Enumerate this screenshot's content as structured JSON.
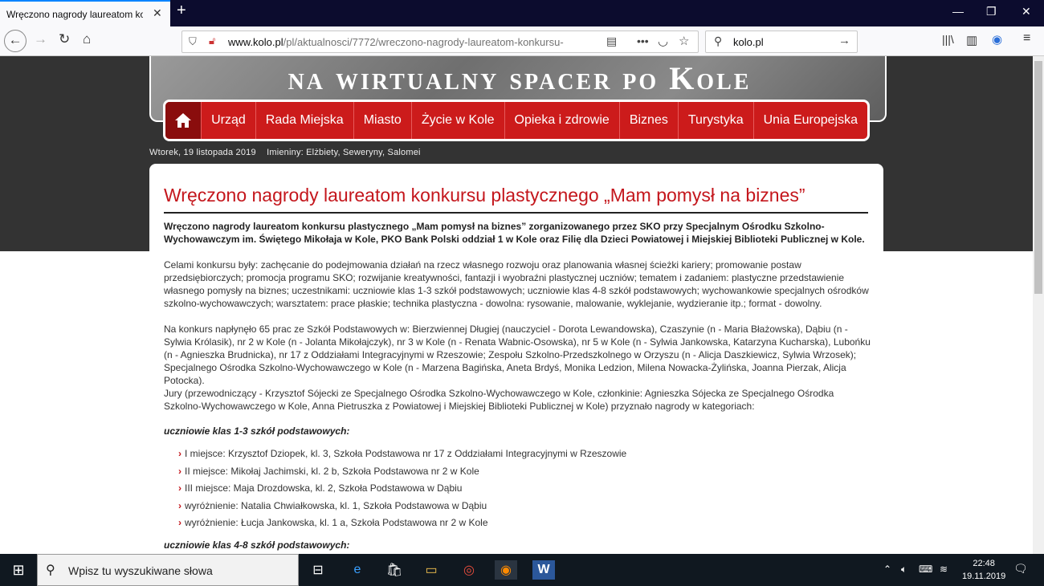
{
  "browser": {
    "tab_title": "Wręczono nagrody laureatom konk",
    "url_domain": "www.kolo.pl",
    "url_path": "/pl/aktualnosci/7772/wreczono-nagrody-laureatom-konkursu-",
    "search_value": "kolo.pl",
    "more": "•••"
  },
  "banner": {
    "text": "na wirtualny spacer po Kole"
  },
  "menu": {
    "items": [
      "Urząd",
      "Rada Miejska",
      "Miasto",
      "Życie w Kole",
      "Opieka i zdrowie",
      "Biznes",
      "Turystyka",
      "Unia Europejska"
    ]
  },
  "dateline": {
    "date": "Wtorek, 19 listopada 2019",
    "names": "Imieniny: Elżbiety, Seweryny, Salomei"
  },
  "article": {
    "title": "Wręczono nagrody laureatom konkursu plastycznego „Mam pomysł na biznes”",
    "lead": "Wręczono nagrody laureatom konkursu plastycznego „Mam pomysł na biznes” zorganizowanego przez SKO przy Specjalnym Ośrodku Szkolno-Wychowawczym im. Świętego Mikołaja w Kole, PKO Bank Polski oddział 1 w Kole oraz Filię dla Dzieci Powiatowej i Miejskiej Biblioteki Publicznej w Kole.",
    "p1": "Celami konkursu były: zachęcanie do podejmowania działań na rzecz własnego rozwoju oraz planowania własnej ścieżki kariery; promowanie postaw przedsiębiorczych; promocja programu SKO; rozwijanie kreatywności, fantazji i wyobraźni plastycznej uczniów; tematem i zadaniem: plastyczne przedstawienie własnego pomysły na biznes; uczestnikami: uczniowie klas 1-3 szkół podstawowych; uczniowie klas 4-8 szkół podstawowych; wychowankowie specjalnych ośrodków szkolno-wychowawczych; warsztatem: prace płaskie; technika plastyczna - dowolna: rysowanie, malowanie, wyklejanie, wydzieranie itp.; format - dowolny.",
    "p2": "Na konkurs napłynęło 65 prac ze Szkół Podstawowych w: Bierzwiennej Długiej (nauczyciel - Dorota Lewandowska), Czaszynie (n - Maria Błażowska), Dąbiu (n - Sylwia Królasik), nr 2 w Kole (n - Jolanta Mikołajczyk), nr 3 w Kole (n - Renata Wabnic-Osowska), nr 5 w Kole (n - Sylwia Jankowska, Katarzyna Kucharska), Lubońku (n - Agnieszka Brudnicka), nr 17 z Oddziałami Integracyjnymi w Rzeszowie; Zespołu Szkolno-Przedszkolnego w Orzyszu (n - Alicja Daszkiewicz, Sylwia Wrzosek); Specjalnego Ośrodka Szkolno-Wychowawczego w Kole (n - Marzena Bagińska, Aneta Brdyś, Monika Ledzion, Milena Nowacka-Żylińska, Joanna Pierzak, Alicja Potocka).",
    "p3": "Jury (przewodniczący - Krzysztof Sójecki ze Specjalnego Ośrodka Szkolno-Wychowawczego w Kole, członkinie: Agnieszka Sójecka ze Specjalnego Ośrodka Szkolno-Wychowawczego w Kole, Anna Pietruszka z Powiatowej i Miejskiej Biblioteki Publicznej w Kole) przyznało nagrody w kategoriach:",
    "cat1": "uczniowie klas 1-3 szkół podstawowych:",
    "list1": [
      "I miejsce: Krzysztof Dziopek, kl. 3, Szkoła Podstawowa nr 17 z Oddziałami Integracyjnymi w Rzeszowie",
      "II miejsce: Mikołaj Jachimski, kl. 2 b, Szkoła Podstawowa nr 2 w Kole",
      "III miejsce: Maja Drozdowska, kl. 2, Szkoła Podstawowa w Dąbiu",
      "wyróżnienie: Natalia Chwiałkowska, kl. 1, Szkoła Podstawowa w Dąbiu",
      "wyróżnienie: Łucja Jankowska, kl. 1 a, Szkoła Podstawowa nr 2 w Kole"
    ],
    "cat2": "uczniowie klas 4-8 szkół podstawowych:"
  },
  "taskbar": {
    "search_placeholder": "Wpisz tu wyszukiwane słowa",
    "time": "22:48",
    "date": "19.11.2019"
  }
}
